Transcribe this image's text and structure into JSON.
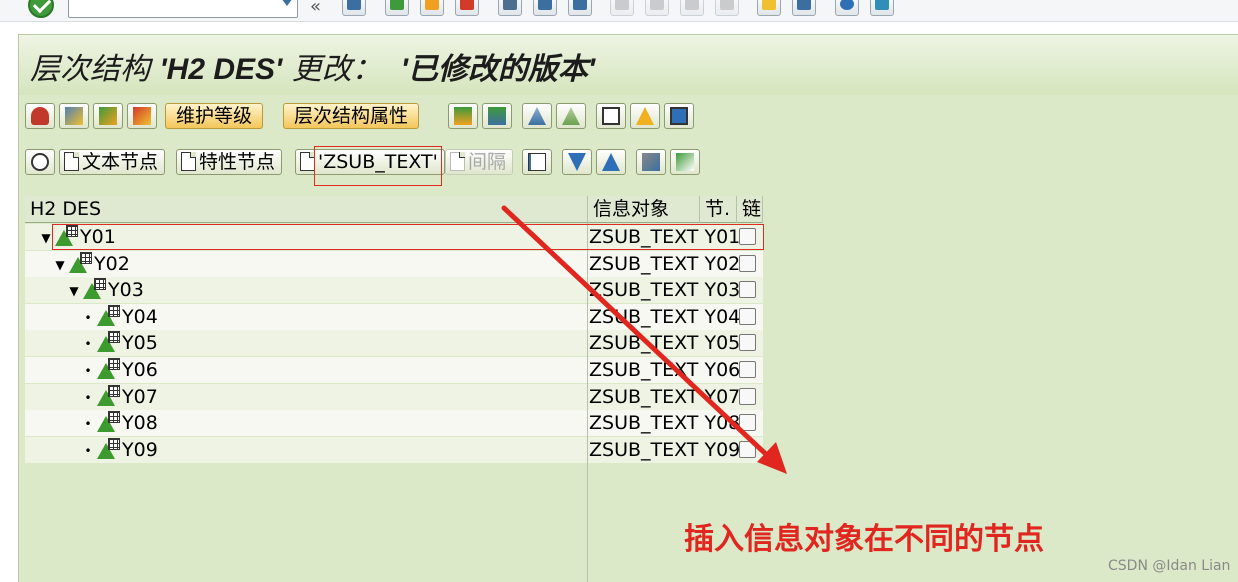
{
  "title": {
    "prefix": "层次结构 ",
    "name": "'H2 DES'",
    "middle": " 更改：  ",
    "version": "'已修改的版本'"
  },
  "toolbar1": {
    "maintain_level": "维护等级",
    "hierarchy_attributes": "层次结构属性"
  },
  "toolbar2": {
    "text_node": "文本节点",
    "characteristic_node": "特性节点",
    "zsub_text": "'ZSUB_TEXT'",
    "interval": "间隔"
  },
  "tree": {
    "columns": [
      "H2 DES",
      "信息对象",
      "节.",
      "链"
    ],
    "rows": [
      {
        "node": "Y01",
        "info": "ZSUB_TEXT Y01",
        "level": 0,
        "expander": "▼"
      },
      {
        "node": "Y02",
        "info": "ZSUB_TEXT Y02",
        "level": 1,
        "expander": "▼"
      },
      {
        "node": "Y03",
        "info": "ZSUB_TEXT Y03",
        "level": 2,
        "expander": "▼"
      },
      {
        "node": "Y04",
        "info": "ZSUB_TEXT Y04",
        "level": 3,
        "expander": "•"
      },
      {
        "node": "Y05",
        "info": "ZSUB_TEXT Y05",
        "level": 3,
        "expander": "•"
      },
      {
        "node": "Y06",
        "info": "ZSUB_TEXT Y06",
        "level": 3,
        "expander": "•"
      },
      {
        "node": "Y07",
        "info": "ZSUB_TEXT Y07",
        "level": 3,
        "expander": "•"
      },
      {
        "node": "Y08",
        "info": "ZSUB_TEXT Y08",
        "level": 3,
        "expander": "•"
      },
      {
        "node": "Y09",
        "info": "ZSUB_TEXT Y09",
        "level": 3,
        "expander": "•"
      }
    ]
  },
  "annotation": "插入信息对象在不同的节点",
  "watermark": "CSDN @Idan Lian",
  "colors": {
    "accent_red": "#e0261e",
    "panel_green": "#dce9c8",
    "node_green": "#3c9a2e"
  }
}
